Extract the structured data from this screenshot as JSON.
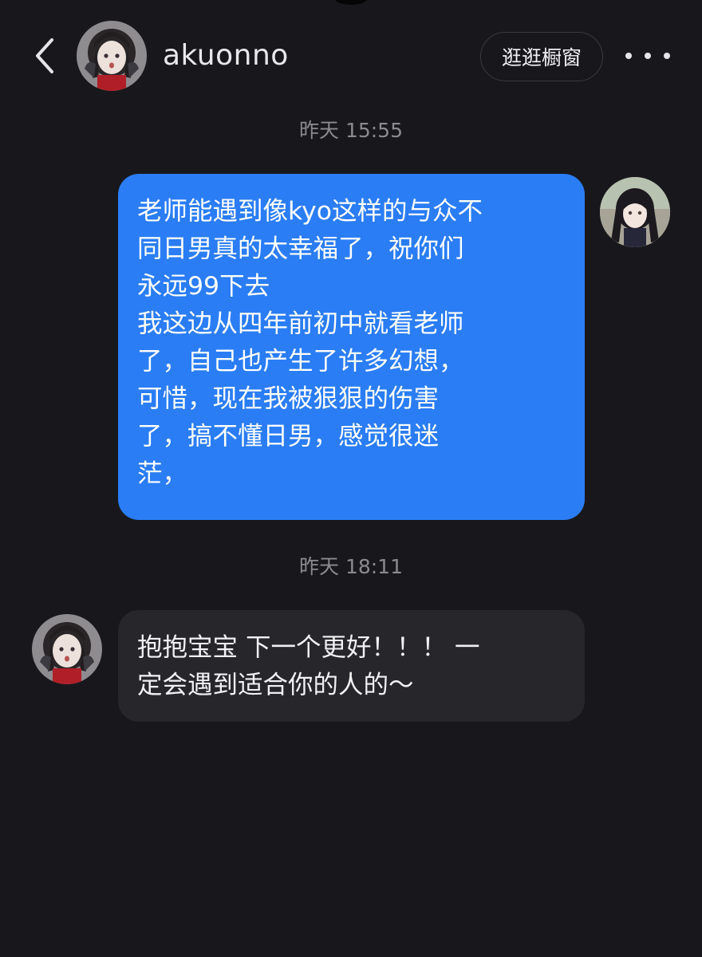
{
  "header": {
    "username": "akuonno",
    "shop_button": "逛逛橱窗",
    "back_icon": "chevron-left-icon",
    "more_icon": "more-dots-icon"
  },
  "messages": [
    {
      "timestamp": "昨天 15:55",
      "direction": "outgoing",
      "text": "老师能遇到像kyo这样的与众不\n同日男真的太幸福了，祝你们\n永远99下去\n我这边从四年前初中就看老师\n了，自己也产生了许多幻想，\n可惜，现在我被狠狠的伤害\n了，搞不懂日男，感觉很迷\n茫，"
    },
    {
      "timestamp": "昨天 18:11",
      "direction": "incoming",
      "text": "抱抱宝宝 下一个更好！！！ 一\n定会遇到适合你的人的～"
    }
  ],
  "colors": {
    "background": "#18181c",
    "outgoing_bubble": "#2a7df5",
    "incoming_bubble": "#26262b",
    "timestamp": "#8a8a90"
  }
}
